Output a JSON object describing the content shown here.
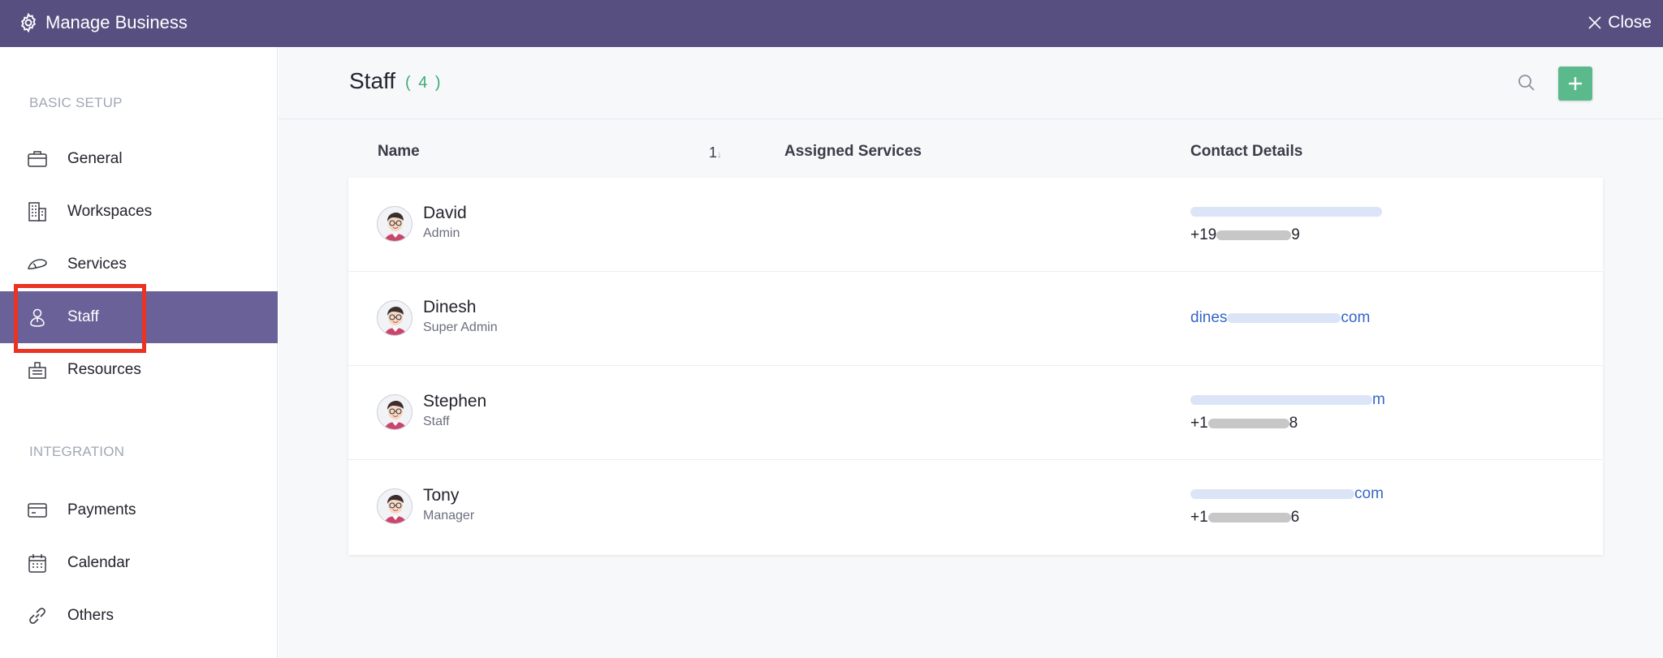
{
  "topbar": {
    "title": "Manage Business",
    "close_label": "Close",
    "background": "#574f80"
  },
  "sidebar": {
    "sections": [
      {
        "label": "BASIC SETUP"
      },
      {
        "label": "INTEGRATION"
      }
    ],
    "items": [
      {
        "label": "General",
        "icon": "briefcase-icon"
      },
      {
        "label": "Workspaces",
        "icon": "building-icon"
      },
      {
        "label": "Services",
        "icon": "services-icon"
      },
      {
        "label": "Staff",
        "icon": "person-pin-icon",
        "active": true
      },
      {
        "label": "Resources",
        "icon": "resources-icon"
      },
      {
        "label": "Payments",
        "icon": "credit-card-icon"
      },
      {
        "label": "Calendar",
        "icon": "calendar-icon"
      },
      {
        "label": "Others",
        "icon": "link-icon"
      }
    ],
    "active_color": "#6b6199",
    "highlight_color": "#ea3323"
  },
  "main": {
    "title": "Staff",
    "count": "( 4 )",
    "accent": "#5bba8b",
    "columns": {
      "name": "Name",
      "sort": "1",
      "sort_arrow": "↓",
      "services": "Assigned Services",
      "contact": "Contact Details"
    },
    "staff": [
      {
        "name": "David",
        "role": "Admin",
        "email_prefix": "",
        "email_suffix": "",
        "phone_prefix": "+19",
        "phone_suffix": "9"
      },
      {
        "name": "Dinesh",
        "role": "Super Admin",
        "email_prefix": "dines",
        "email_suffix": "com",
        "phone_prefix": "",
        "phone_suffix": ""
      },
      {
        "name": "Stephen",
        "role": "Staff",
        "email_prefix": "",
        "email_suffix": "m",
        "phone_prefix": "+1",
        "phone_suffix": "8"
      },
      {
        "name": "Tony",
        "role": "Manager",
        "email_prefix": "",
        "email_suffix": "com",
        "phone_prefix": "+1",
        "phone_suffix": "6"
      }
    ]
  }
}
